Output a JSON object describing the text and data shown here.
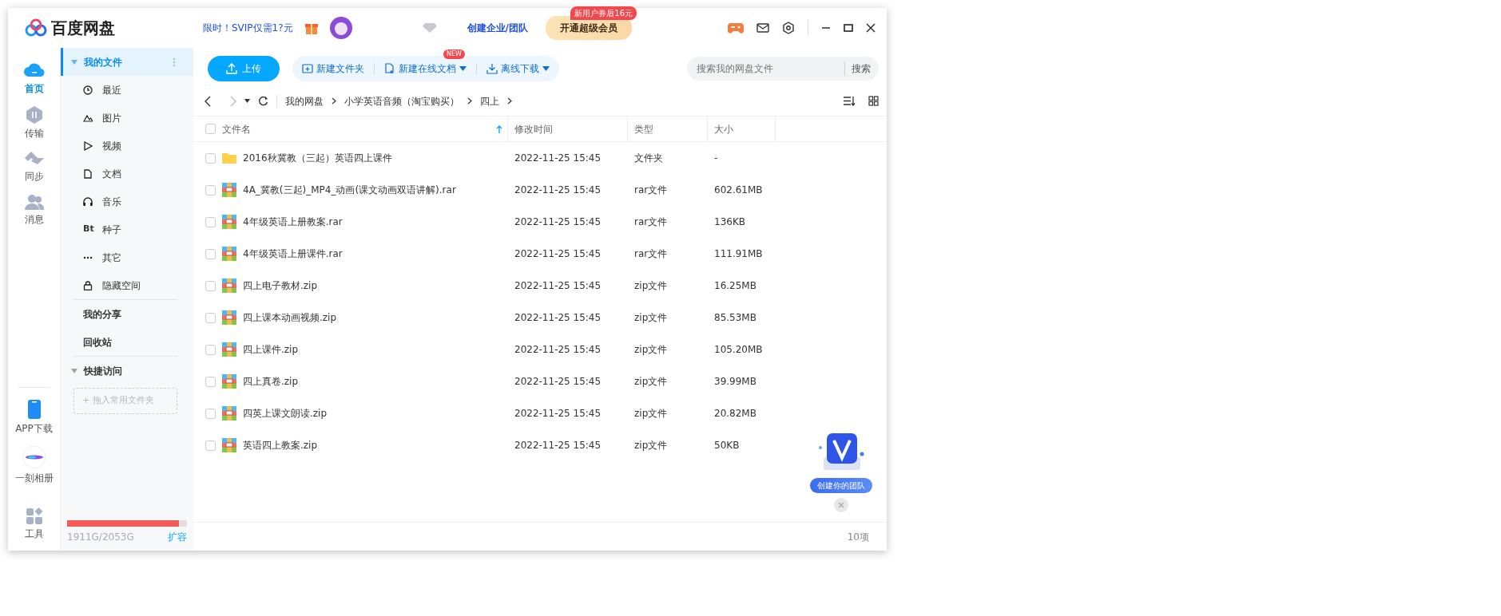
{
  "window": {
    "app_name": "百度网盘"
  },
  "header": {
    "promo": "限时！SVIP仅需1?元",
    "team_link": "创建企业/团队",
    "vip_button": "开通超级会员",
    "vip_badge": "新用户券后16元"
  },
  "rail": [
    {
      "label": "首页",
      "kind": "cloud",
      "selected": true
    },
    {
      "label": "传输",
      "kind": "transfer",
      "selected": false
    },
    {
      "label": "同步",
      "kind": "sync",
      "selected": false
    },
    {
      "label": "消息",
      "kind": "people",
      "selected": false
    }
  ],
  "rail_bottom": [
    {
      "label": "APP下载",
      "kind": "phone"
    },
    {
      "label": "一刻相册",
      "kind": "album"
    },
    {
      "label": "工具",
      "kind": "tools"
    }
  ],
  "nav": {
    "my_files": {
      "label": "我的文件",
      "expanded": true,
      "selected": true
    },
    "categories": [
      {
        "label": "最近",
        "kind": "clock"
      },
      {
        "label": "图片",
        "kind": "mountain"
      },
      {
        "label": "视频",
        "kind": "play"
      },
      {
        "label": "文档",
        "kind": "doc"
      },
      {
        "label": "音乐",
        "kind": "headphones"
      },
      {
        "label": "种子",
        "kind": "bt",
        "glyph": "Bt"
      },
      {
        "label": "其它",
        "kind": "dots"
      },
      {
        "label": "隐藏空间",
        "kind": "lock"
      }
    ],
    "links": [
      "我的分享",
      "回收站"
    ],
    "quick": {
      "label": "快捷访问",
      "expanded": true,
      "drop_hint": "+ 拖入常用文件夹"
    }
  },
  "storage": {
    "level": 0.93,
    "reading": "1911G/2053G",
    "expand": "扩容"
  },
  "toolbar": {
    "upload": "上传",
    "actions": [
      {
        "label": "新建文件夹",
        "kind": "folder",
        "dropdown": false
      },
      {
        "label": "新建在线文档",
        "kind": "doc",
        "dropdown": true,
        "badge": "NEW"
      },
      {
        "label": "离线下载",
        "kind": "download",
        "dropdown": true
      }
    ]
  },
  "search": {
    "placeholder": "搜索我的网盘文件",
    "button": "搜索"
  },
  "breadcrumb": [
    "我的网盘",
    "小学英语音频（淘宝购买）",
    "四上"
  ],
  "table": {
    "select_all_checked": false,
    "columns": [
      {
        "label": "文件名",
        "sorted": true
      },
      {
        "label": "修改时间",
        "sorted": false
      },
      {
        "label": "类型",
        "sorted": false
      },
      {
        "label": "大小",
        "sorted": false
      }
    ],
    "rows": [
      {
        "name": "2016秋冀教（三起）英语四上课件",
        "kind": "folder",
        "modified": "2022-11-25 15:45",
        "type": "文件夹",
        "size": "-",
        "checked": false
      },
      {
        "name": "4A_冀教(三起)_MP4_动画(课文动画双语讲解).rar",
        "kind": "archive",
        "modified": "2022-11-25 15:45",
        "type": "rar文件",
        "size": "602.61MB",
        "checked": false
      },
      {
        "name": "4年级英语上册教案.rar",
        "kind": "archive",
        "modified": "2022-11-25 15:45",
        "type": "rar文件",
        "size": "136KB",
        "checked": false
      },
      {
        "name": "4年级英语上册课件.rar",
        "kind": "archive",
        "modified": "2022-11-25 15:45",
        "type": "rar文件",
        "size": "111.91MB",
        "checked": false
      },
      {
        "name": "四上电子教材.zip",
        "kind": "archive",
        "modified": "2022-11-25 15:45",
        "type": "zip文件",
        "size": "16.25MB",
        "checked": false
      },
      {
        "name": "四上课本动画视频.zip",
        "kind": "archive",
        "modified": "2022-11-25 15:45",
        "type": "zip文件",
        "size": "85.53MB",
        "checked": false
      },
      {
        "name": "四上课件.zip",
        "kind": "archive",
        "modified": "2022-11-25 15:45",
        "type": "zip文件",
        "size": "105.20MB",
        "checked": false
      },
      {
        "name": "四上真卷.zip",
        "kind": "archive",
        "modified": "2022-11-25 15:45",
        "type": "zip文件",
        "size": "39.99MB",
        "checked": false
      },
      {
        "name": "四英上课文朗读.zip",
        "kind": "archive",
        "modified": "2022-11-25 15:45",
        "type": "zip文件",
        "size": "20.82MB",
        "checked": false
      },
      {
        "name": "英语四上教案.zip",
        "kind": "archive",
        "modified": "2022-11-25 15:45",
        "type": "zip文件",
        "size": "50KB",
        "checked": false
      }
    ]
  },
  "promo_widget": {
    "label": "创建你的团队"
  },
  "footer": {
    "count": "10项"
  }
}
